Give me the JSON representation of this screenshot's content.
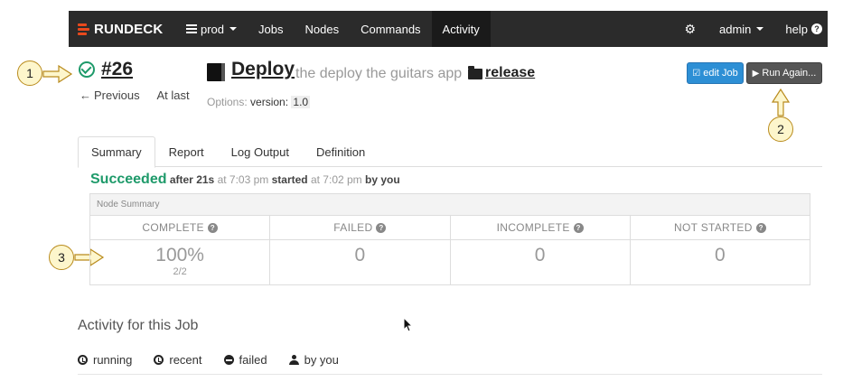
{
  "navbar": {
    "brand": "RUNDECK",
    "project": "prod",
    "items": [
      "Jobs",
      "Nodes",
      "Commands",
      "Activity"
    ],
    "active": "Activity",
    "user": "admin",
    "help": "help"
  },
  "callouts": [
    "1",
    "2",
    "3"
  ],
  "execution": {
    "id": "#26",
    "prev": "Previous",
    "last": "At last"
  },
  "job": {
    "name": "Deploy",
    "description": "the deploy the guitars app",
    "group": "release",
    "options_label": "Options:",
    "option_name": "version:",
    "option_value": "1.0"
  },
  "buttons": {
    "edit": "edit Job",
    "run": "Run Again..."
  },
  "tabs": [
    "Summary",
    "Report",
    "Log Output",
    "Definition"
  ],
  "status": {
    "state": "Succeeded",
    "after": "after",
    "duration": "21s",
    "at": "at 7:03 pm",
    "started": "started",
    "start_at": "at 7:02 pm",
    "by": "by you"
  },
  "node_summary": {
    "title": "Node Summary",
    "columns": [
      {
        "label": "COMPLETE",
        "value": "100%",
        "sub": "2/2"
      },
      {
        "label": "FAILED",
        "value": "0",
        "sub": ""
      },
      {
        "label": "INCOMPLETE",
        "value": "0",
        "sub": ""
      },
      {
        "label": "NOT STARTED",
        "value": "0",
        "sub": ""
      }
    ]
  },
  "activity": {
    "title": "Activity for this Job",
    "filters": [
      "running",
      "recent",
      "failed",
      "by you"
    ]
  },
  "colors": {
    "navbar": "#2b2b2b",
    "success": "#1e9a6a",
    "primary": "#2d8fd5",
    "brand": "#e8491d",
    "callout": "#fdf6cc"
  }
}
